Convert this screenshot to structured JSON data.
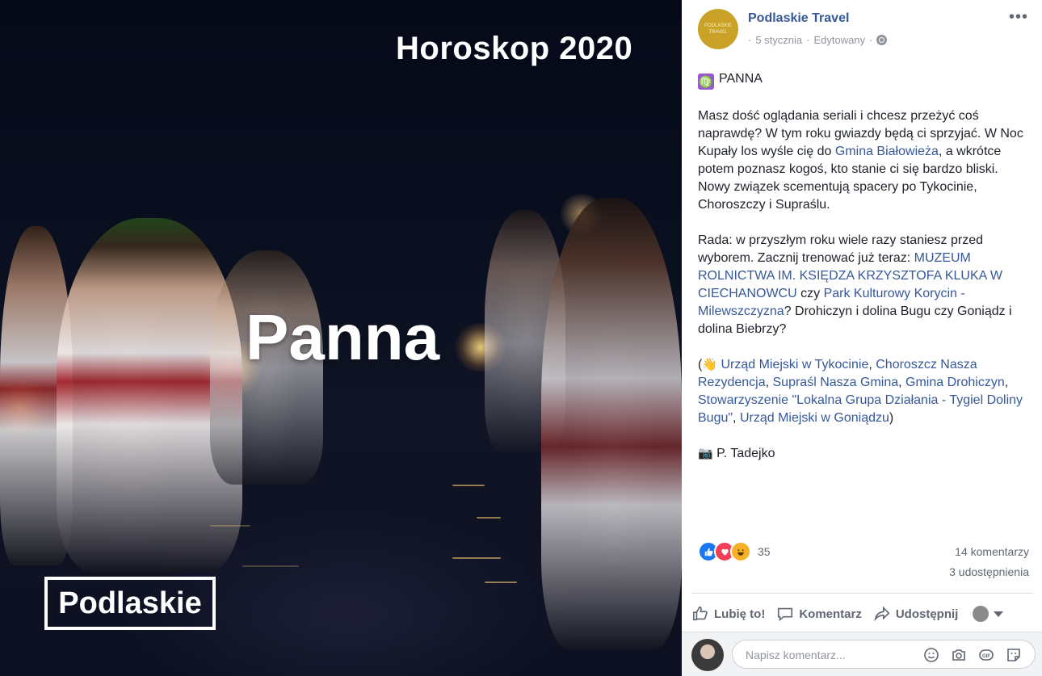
{
  "photo": {
    "title": "Horoskop 2020",
    "sign": "Panna",
    "brand": "Podlaskie"
  },
  "post": {
    "page_name": "Podlaskie Travel",
    "avatar_text": "PODLASKIE TRAVEL",
    "date": "5 stycznia",
    "edited": "Edytowany",
    "sep": "·",
    "more": "•••",
    "sign_icon": "♍",
    "sign_label": "PANNA",
    "p1_a": "Masz dość oglądania seriali i chcesz przeżyć coś naprawdę? W tym roku gwiazdy będą ci sprzyjać. W Noc Kupały los wyśle cię do ",
    "p1_link": "Gmina Białowieża",
    "p1_b": ", a wkrótce potem poznasz kogoś, kto stanie ci się bardzo bliski. Nowy związek scementują spacery po Tykocinie, Choroszczy i Supraślu.",
    "p2_a": "Rada: w przyszłym roku wiele razy staniesz przed wyborem. Zacznij trenować już teraz: ",
    "p2_link1": "MUZEUM ROLNICTWA IM. KSIĘDZA KRZYSZTOFA KLUKA W CIECHANOWCU",
    "p2_b": " czy ",
    "p2_link2": "Park Kulturowy Korycin - Milewszczyzna",
    "p2_c": "? Drohiczyn i dolina Bugu czy Goniądz i dolina Biebrzy?",
    "p3_open": "(",
    "p3_emoji": "👋",
    "p3_link1": "Urząd Miejski w Tykocinie",
    "p3_link2": "Choroszcz Nasza Rezydencja",
    "p3_link3": "Supraśl Nasza Gmina",
    "p3_link4": "Gmina Drohiczyn",
    "p3_link5": "Stowarzyszenie \"Lokalna Grupa Działania - Tygiel Doliny Bugu\"",
    "p3_link6": "Urząd Miejski w Goniądzu",
    "p3_close": ")",
    "comma": ", ",
    "credit_emoji": "📷",
    "credit": "P. Tadejko"
  },
  "stats": {
    "reactions": "35",
    "comments": "14 komentarzy",
    "shares": "3 udostępnienia"
  },
  "actions": {
    "like": "Lubię to!",
    "comment": "Komentarz",
    "share": "Udostępnij"
  },
  "composer": {
    "placeholder": "Napisz komentarz..."
  },
  "colors": {
    "link": "#365899",
    "like_blue": "#1877f2",
    "love_red": "#f33e58",
    "haha_yellow": "#f7b125"
  }
}
